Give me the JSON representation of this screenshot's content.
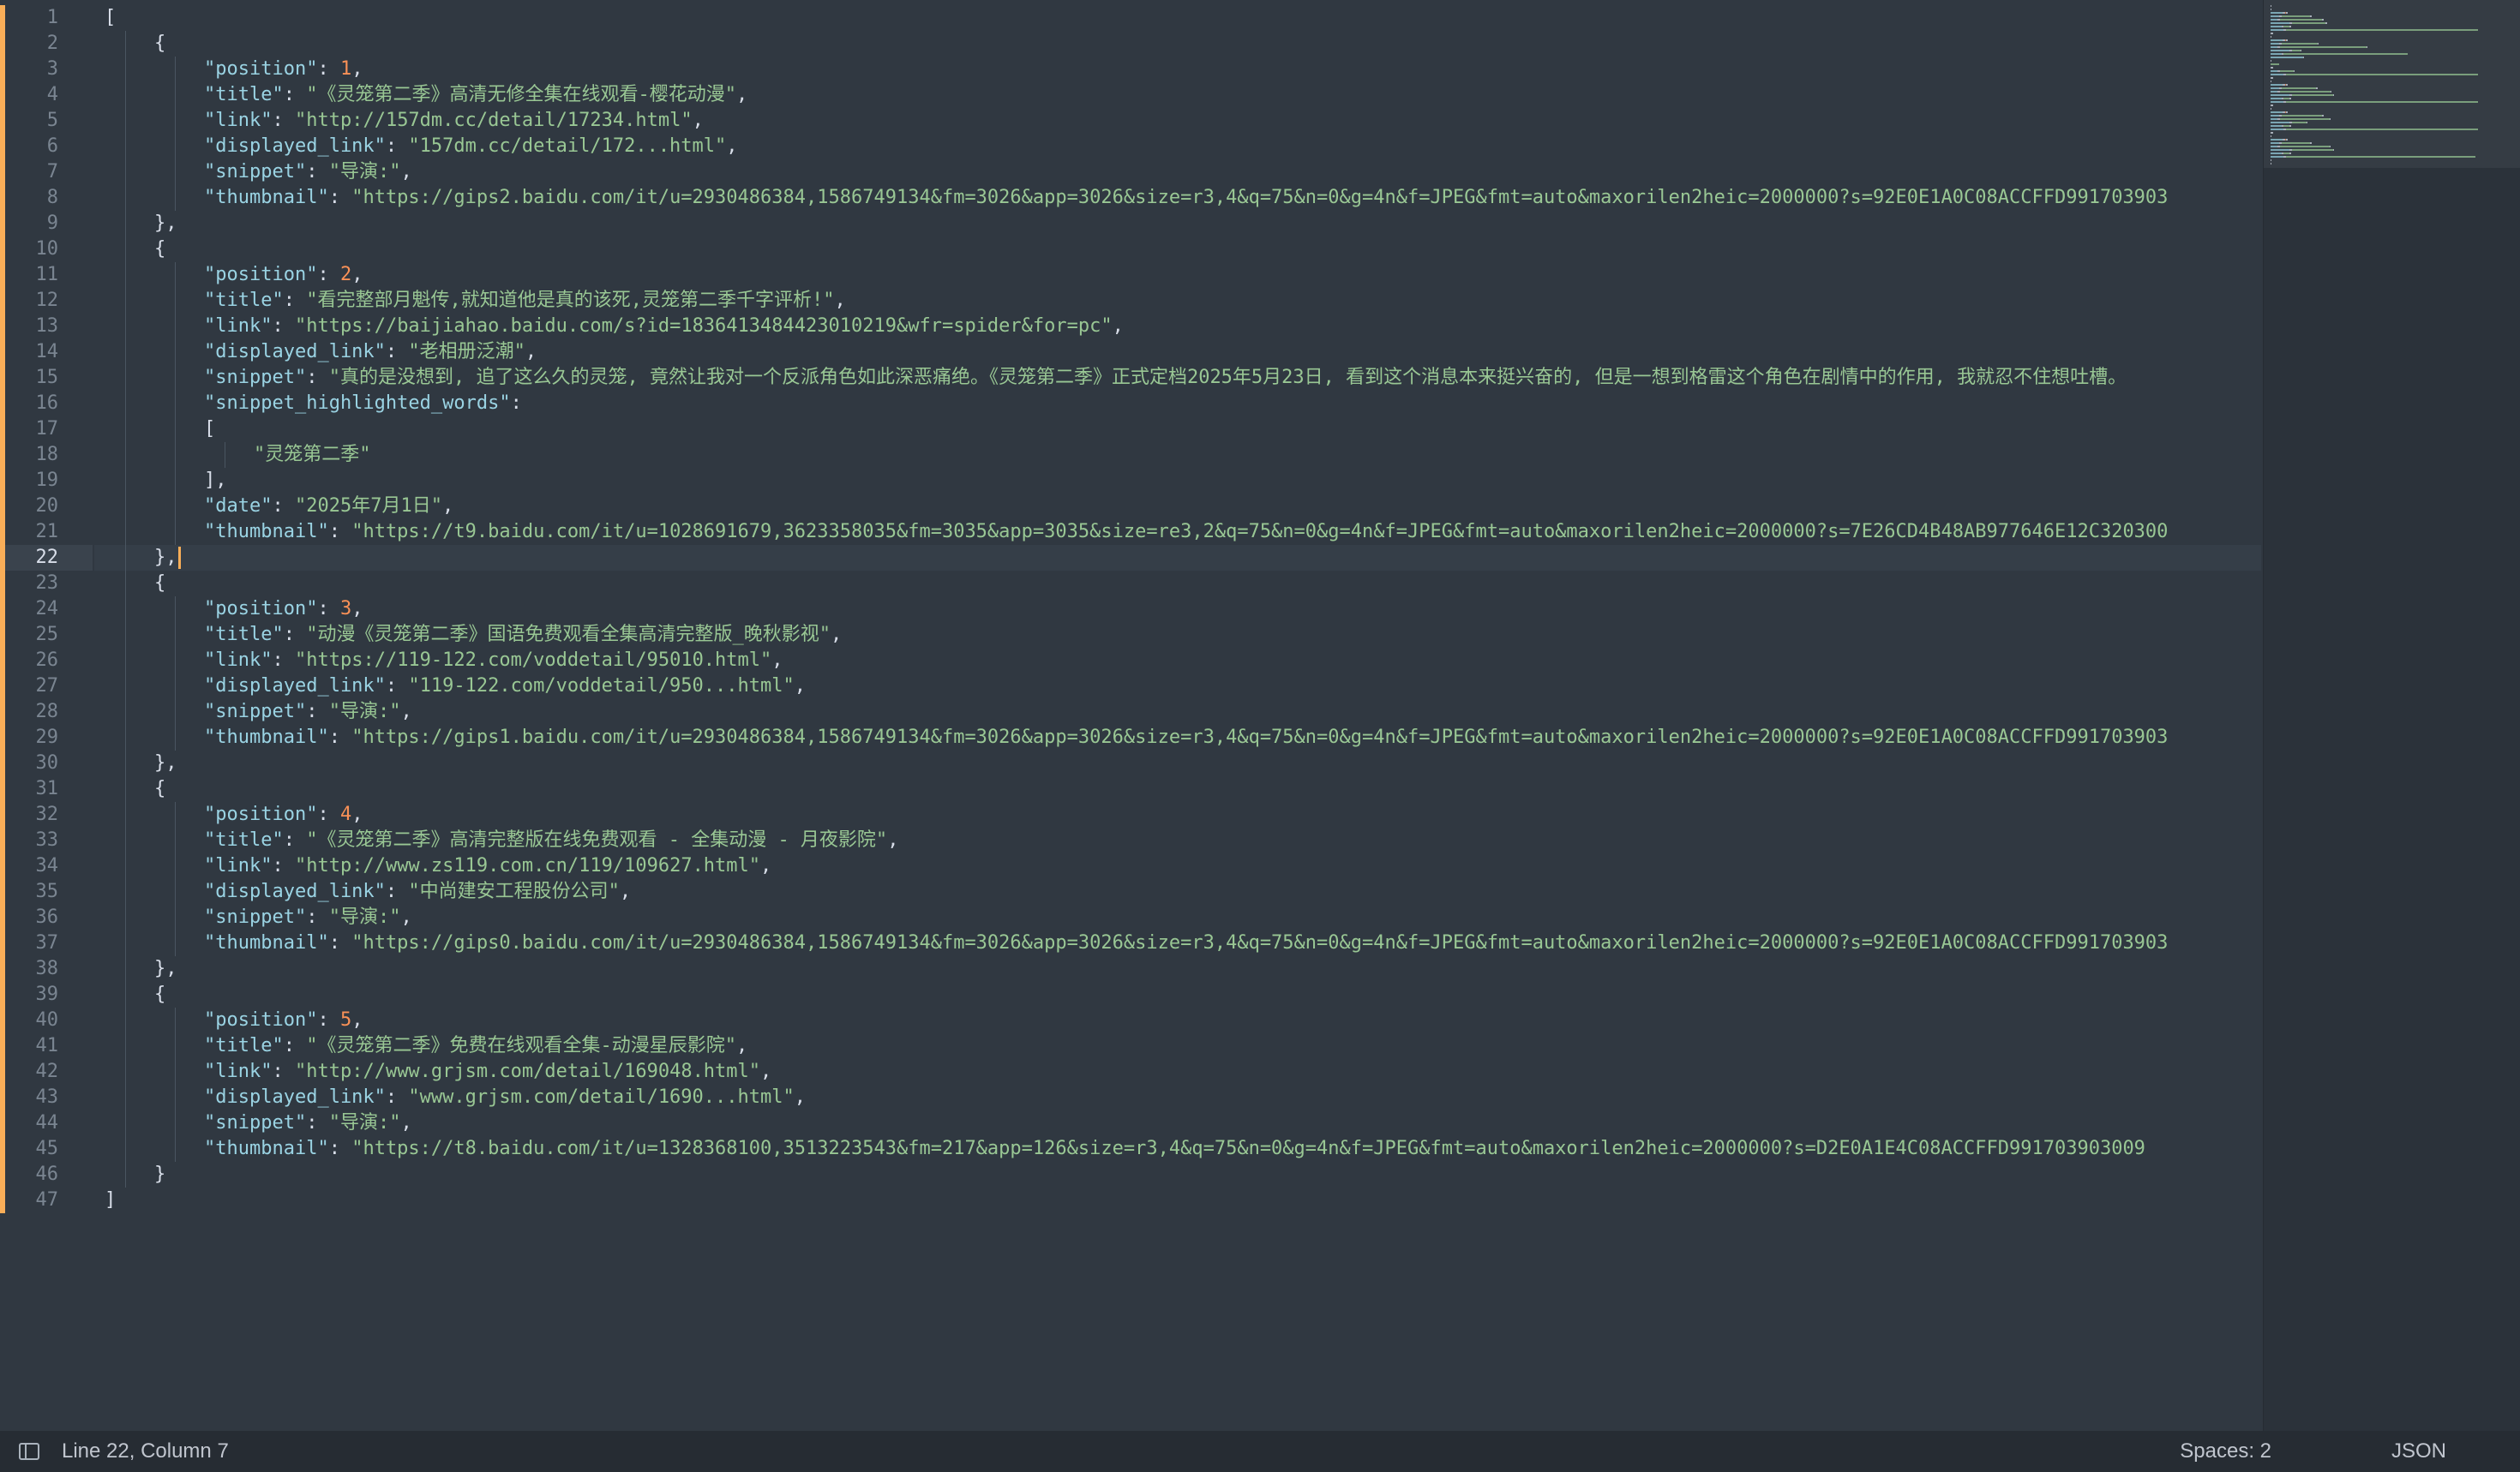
{
  "editor": {
    "active_line": 22,
    "lines": [
      [
        {
          "t": "[",
          "c": "p"
        }
      ],
      [
        {
          "t": "{",
          "c": "p"
        }
      ],
      [
        {
          "t": "\"position\"",
          "c": "k"
        },
        {
          "t": ": ",
          "c": "p"
        },
        {
          "t": "1",
          "c": "n"
        },
        {
          "t": ",",
          "c": "p"
        }
      ],
      [
        {
          "t": "\"title\"",
          "c": "k"
        },
        {
          "t": ": ",
          "c": "p"
        },
        {
          "t": "\"《灵笼第二季》高清无修全集在线观看-樱花动漫\"",
          "c": "s"
        },
        {
          "t": ",",
          "c": "p"
        }
      ],
      [
        {
          "t": "\"link\"",
          "c": "k"
        },
        {
          "t": ": ",
          "c": "p"
        },
        {
          "t": "\"http://157dm.cc/detail/17234.html\"",
          "c": "s"
        },
        {
          "t": ",",
          "c": "p"
        }
      ],
      [
        {
          "t": "\"displayed_link\"",
          "c": "k"
        },
        {
          "t": ": ",
          "c": "p"
        },
        {
          "t": "\"157dm.cc/detail/172...html\"",
          "c": "s"
        },
        {
          "t": ",",
          "c": "p"
        }
      ],
      [
        {
          "t": "\"snippet\"",
          "c": "k"
        },
        {
          "t": ": ",
          "c": "p"
        },
        {
          "t": "\"导演:\"",
          "c": "s"
        },
        {
          "t": ",",
          "c": "p"
        }
      ],
      [
        {
          "t": "\"thumbnail\"",
          "c": "k"
        },
        {
          "t": ": ",
          "c": "p"
        },
        {
          "t": "\"https://gips2.baidu.com/it/u=2930486384,1586749134&fm=3026&app=3026&size=r3,4&q=75&n=0&g=4n&f=JPEG&fmt=auto&maxorilen2heic=2000000?s=92E0E1A0C08ACCFFD991703903",
          "c": "s"
        }
      ],
      [
        {
          "t": "},",
          "c": "p"
        }
      ],
      [
        {
          "t": "{",
          "c": "p"
        }
      ],
      [
        {
          "t": "\"position\"",
          "c": "k"
        },
        {
          "t": ": ",
          "c": "p"
        },
        {
          "t": "2",
          "c": "n"
        },
        {
          "t": ",",
          "c": "p"
        }
      ],
      [
        {
          "t": "\"title\"",
          "c": "k"
        },
        {
          "t": ": ",
          "c": "p"
        },
        {
          "t": "\"看完整部月魁传,就知道他是真的该死,灵笼第二季千字评析!\"",
          "c": "s"
        },
        {
          "t": ",",
          "c": "p"
        }
      ],
      [
        {
          "t": "\"link\"",
          "c": "k"
        },
        {
          "t": ": ",
          "c": "p"
        },
        {
          "t": "\"https://baijiahao.baidu.com/s?id=1836413484423010219&wfr=spider&for=pc\"",
          "c": "s"
        },
        {
          "t": ",",
          "c": "p"
        }
      ],
      [
        {
          "t": "\"displayed_link\"",
          "c": "k"
        },
        {
          "t": ": ",
          "c": "p"
        },
        {
          "t": "\"老相册泛潮\"",
          "c": "s"
        },
        {
          "t": ",",
          "c": "p"
        }
      ],
      [
        {
          "t": "\"snippet\"",
          "c": "k"
        },
        {
          "t": ": ",
          "c": "p"
        },
        {
          "t": "\"真的是没想到, 追了这么久的灵笼, 竟然让我对一个反派角色如此深恶痛绝。《灵笼第二季》正式定档2025年5月23日, 看到这个消息本来挺兴奋的, 但是一想到格雷这个角色在剧情中的作用, 我就忍不住想吐槽。",
          "c": "s"
        }
      ],
      [
        {
          "t": "\"snippet_highlighted_words\"",
          "c": "k"
        },
        {
          "t": ":",
          "c": "p"
        }
      ],
      [
        {
          "t": "[",
          "c": "p"
        }
      ],
      [
        {
          "t": "\"灵笼第二季\"",
          "c": "s"
        }
      ],
      [
        {
          "t": "],",
          "c": "p"
        }
      ],
      [
        {
          "t": "\"date\"",
          "c": "k"
        },
        {
          "t": ": ",
          "c": "p"
        },
        {
          "t": "\"2025年7月1日\"",
          "c": "s"
        },
        {
          "t": ",",
          "c": "p"
        }
      ],
      [
        {
          "t": "\"thumbnail\"",
          "c": "k"
        },
        {
          "t": ": ",
          "c": "p"
        },
        {
          "t": "\"https://t9.baidu.com/it/u=1028691679,3623358035&fm=3035&app=3035&size=re3,2&q=75&n=0&g=4n&f=JPEG&fmt=auto&maxorilen2heic=2000000?s=7E26CD4B48AB977646E12C320300",
          "c": "s"
        }
      ],
      [
        {
          "t": "},",
          "c": "p"
        }
      ],
      [
        {
          "t": "{",
          "c": "p"
        }
      ],
      [
        {
          "t": "\"position\"",
          "c": "k"
        },
        {
          "t": ": ",
          "c": "p"
        },
        {
          "t": "3",
          "c": "n"
        },
        {
          "t": ",",
          "c": "p"
        }
      ],
      [
        {
          "t": "\"title\"",
          "c": "k"
        },
        {
          "t": ": ",
          "c": "p"
        },
        {
          "t": "\"动漫《灵笼第二季》国语免费观看全集高清完整版_晚秋影视\"",
          "c": "s"
        },
        {
          "t": ",",
          "c": "p"
        }
      ],
      [
        {
          "t": "\"link\"",
          "c": "k"
        },
        {
          "t": ": ",
          "c": "p"
        },
        {
          "t": "\"https://119-122.com/voddetail/95010.html\"",
          "c": "s"
        },
        {
          "t": ",",
          "c": "p"
        }
      ],
      [
        {
          "t": "\"displayed_link\"",
          "c": "k"
        },
        {
          "t": ": ",
          "c": "p"
        },
        {
          "t": "\"119-122.com/voddetail/950...html\"",
          "c": "s"
        },
        {
          "t": ",",
          "c": "p"
        }
      ],
      [
        {
          "t": "\"snippet\"",
          "c": "k"
        },
        {
          "t": ": ",
          "c": "p"
        },
        {
          "t": "\"导演:\"",
          "c": "s"
        },
        {
          "t": ",",
          "c": "p"
        }
      ],
      [
        {
          "t": "\"thumbnail\"",
          "c": "k"
        },
        {
          "t": ": ",
          "c": "p"
        },
        {
          "t": "\"https://gips1.baidu.com/it/u=2930486384,1586749134&fm=3026&app=3026&size=r3,4&q=75&n=0&g=4n&f=JPEG&fmt=auto&maxorilen2heic=2000000?s=92E0E1A0C08ACCFFD991703903",
          "c": "s"
        }
      ],
      [
        {
          "t": "},",
          "c": "p"
        }
      ],
      [
        {
          "t": "{",
          "c": "p"
        }
      ],
      [
        {
          "t": "\"position\"",
          "c": "k"
        },
        {
          "t": ": ",
          "c": "p"
        },
        {
          "t": "4",
          "c": "n"
        },
        {
          "t": ",",
          "c": "p"
        }
      ],
      [
        {
          "t": "\"title\"",
          "c": "k"
        },
        {
          "t": ": ",
          "c": "p"
        },
        {
          "t": "\"《灵笼第二季》高清完整版在线免费观看 - 全集动漫 - 月夜影院\"",
          "c": "s"
        },
        {
          "t": ",",
          "c": "p"
        }
      ],
      [
        {
          "t": "\"link\"",
          "c": "k"
        },
        {
          "t": ": ",
          "c": "p"
        },
        {
          "t": "\"http://www.zs119.com.cn/119/109627.html\"",
          "c": "s"
        },
        {
          "t": ",",
          "c": "p"
        }
      ],
      [
        {
          "t": "\"displayed_link\"",
          "c": "k"
        },
        {
          "t": ": ",
          "c": "p"
        },
        {
          "t": "\"中尚建安工程股份公司\"",
          "c": "s"
        },
        {
          "t": ",",
          "c": "p"
        }
      ],
      [
        {
          "t": "\"snippet\"",
          "c": "k"
        },
        {
          "t": ": ",
          "c": "p"
        },
        {
          "t": "\"导演:\"",
          "c": "s"
        },
        {
          "t": ",",
          "c": "p"
        }
      ],
      [
        {
          "t": "\"thumbnail\"",
          "c": "k"
        },
        {
          "t": ": ",
          "c": "p"
        },
        {
          "t": "\"https://gips0.baidu.com/it/u=2930486384,1586749134&fm=3026&app=3026&size=r3,4&q=75&n=0&g=4n&f=JPEG&fmt=auto&maxorilen2heic=2000000?s=92E0E1A0C08ACCFFD991703903",
          "c": "s"
        }
      ],
      [
        {
          "t": "},",
          "c": "p"
        }
      ],
      [
        {
          "t": "{",
          "c": "p"
        }
      ],
      [
        {
          "t": "\"position\"",
          "c": "k"
        },
        {
          "t": ": ",
          "c": "p"
        },
        {
          "t": "5",
          "c": "n"
        },
        {
          "t": ",",
          "c": "p"
        }
      ],
      [
        {
          "t": "\"title\"",
          "c": "k"
        },
        {
          "t": ": ",
          "c": "p"
        },
        {
          "t": "\"《灵笼第二季》免费在线观看全集-动漫星辰影院\"",
          "c": "s"
        },
        {
          "t": ",",
          "c": "p"
        }
      ],
      [
        {
          "t": "\"link\"",
          "c": "k"
        },
        {
          "t": ": ",
          "c": "p"
        },
        {
          "t": "\"http://www.grjsm.com/detail/169048.html\"",
          "c": "s"
        },
        {
          "t": ",",
          "c": "p"
        }
      ],
      [
        {
          "t": "\"displayed_link\"",
          "c": "k"
        },
        {
          "t": ": ",
          "c": "p"
        },
        {
          "t": "\"www.grjsm.com/detail/1690...html\"",
          "c": "s"
        },
        {
          "t": ",",
          "c": "p"
        }
      ],
      [
        {
          "t": "\"snippet\"",
          "c": "k"
        },
        {
          "t": ": ",
          "c": "p"
        },
        {
          "t": "\"导演:\"",
          "c": "s"
        },
        {
          "t": ",",
          "c": "p"
        }
      ],
      [
        {
          "t": "\"thumbnail\"",
          "c": "k"
        },
        {
          "t": ": ",
          "c": "p"
        },
        {
          "t": "\"https://t8.baidu.com/it/u=1328368100,3513223543&fm=217&app=126&size=r3,4&q=75&n=0&g=4n&f=JPEG&fmt=auto&maxorilen2heic=2000000?s=D2E0A1E4C08ACCFFD991703903009",
          "c": "s"
        }
      ],
      [
        {
          "t": "}",
          "c": "p"
        }
      ],
      [
        {
          "t": "]",
          "c": "p"
        }
      ]
    ]
  },
  "status": {
    "cursor_position": "Line 22, Column 7",
    "indentation": "Spaces: 2",
    "syntax": "JSON"
  },
  "colors": {
    "background": "#303841",
    "key": "#9ad3e3",
    "string": "#99c794",
    "number": "#f99157",
    "punctuation": "#d8dee9",
    "modified_marker": "#f9ae58"
  },
  "icons": {
    "sidebar_toggle": "panel-icon"
  }
}
